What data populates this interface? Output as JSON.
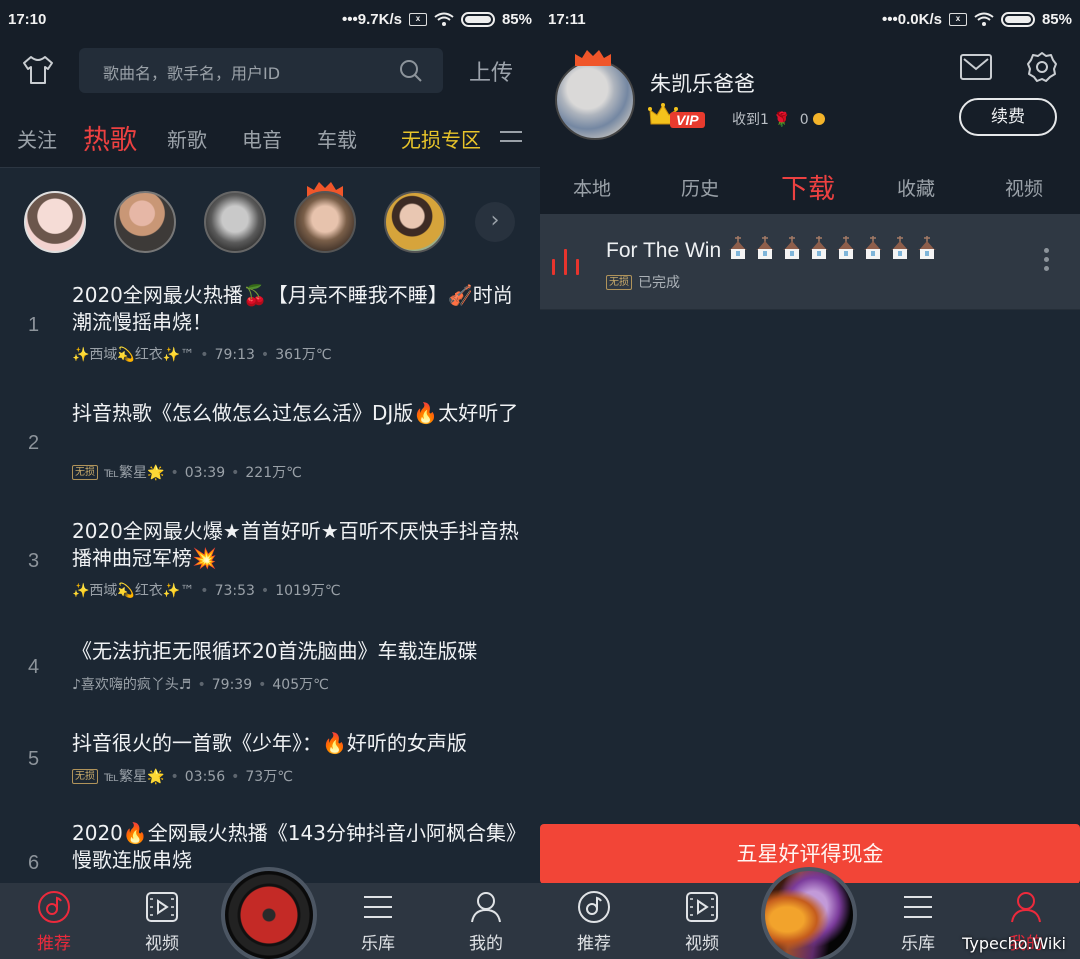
{
  "left": {
    "status": {
      "time": "17:10",
      "net_speed": "•••9.7K/s",
      "battery": "85%"
    },
    "topbar": {
      "search_placeholder": "歌曲名，歌手名，用户ID",
      "upload_label": "上传"
    },
    "categories": [
      {
        "label": "关注",
        "state": "normal"
      },
      {
        "label": "热歌",
        "state": "active"
      },
      {
        "label": "新歌",
        "state": "normal"
      },
      {
        "label": "电音",
        "state": "normal"
      },
      {
        "label": "车载",
        "state": "normal"
      },
      {
        "label": "无损专区",
        "state": "highlight"
      }
    ],
    "songs": [
      {
        "rank": "1",
        "title": "2020全网最火热播🍒【月亮不睡我不睡】🎻时尚潮流慢摇串烧！",
        "lossless": false,
        "uploader": "✨西域💫红衣✨™",
        "duration": "79:13",
        "plays": "361万℃"
      },
      {
        "rank": "2",
        "title": "抖音热歌《怎么做怎么过怎么活》DJ版🔥太好听了",
        "lossless": true,
        "uploader": "℡繁星🌟",
        "duration": "03:39",
        "plays": "221万℃"
      },
      {
        "rank": "3",
        "title": "2020全网最火爆★首首好听★百听不厌快手抖音热播神曲冠军榜💥",
        "lossless": false,
        "uploader": "✨西域💫红衣✨™",
        "duration": "73:53",
        "plays": "1019万℃"
      },
      {
        "rank": "4",
        "title": "《无法抗拒无限循环20首洗脑曲》车载连版碟",
        "lossless": false,
        "uploader": "♪喜欢嗨的疯丫头♬",
        "duration": "79:39",
        "plays": "405万℃"
      },
      {
        "rank": "5",
        "title": "抖音很火的一首歌《少年》：🔥好听的女声版",
        "lossless": true,
        "uploader": "℡繁星🌟",
        "duration": "03:56",
        "plays": "73万℃"
      },
      {
        "rank": "6",
        "title": "2020🔥全网最火热播《143分钟抖音小阿枫合集》慢歌连版串烧",
        "lossless": false,
        "uploader": "",
        "duration": "",
        "plays": ""
      }
    ],
    "lossless_badge": "无损",
    "tabbar": {
      "items": [
        "推荐",
        "视频",
        "乐库",
        "我的"
      ],
      "active": "推荐"
    }
  },
  "right": {
    "status": {
      "time": "17:11",
      "net_speed": "•••0.0K/s",
      "battery": "85%"
    },
    "profile": {
      "name": "朱凯乐爸爸",
      "vip_label": "VIP",
      "received_label": "收到1",
      "flowers": "🌹",
      "coins": "0",
      "renew_label": "续费"
    },
    "tabs": [
      {
        "label": "本地",
        "state": "normal"
      },
      {
        "label": "历史",
        "state": "normal"
      },
      {
        "label": "下载",
        "state": "active"
      },
      {
        "label": "收藏",
        "state": "normal"
      },
      {
        "label": "视频",
        "state": "normal"
      }
    ],
    "download": {
      "title": "For The Win",
      "badge": "无损",
      "status": "已完成",
      "emoji_count": 8
    },
    "promo_label": "五星好评得现金",
    "tabbar": {
      "items": [
        "推荐",
        "视频",
        "乐库",
        "我的"
      ],
      "active": "我的"
    },
    "watermark": "Typecho.Wiki"
  },
  "colors": {
    "accent_red": "#ec4141",
    "gold": "#e8c42a",
    "background": "#1c2733",
    "promo": "#f24537"
  }
}
